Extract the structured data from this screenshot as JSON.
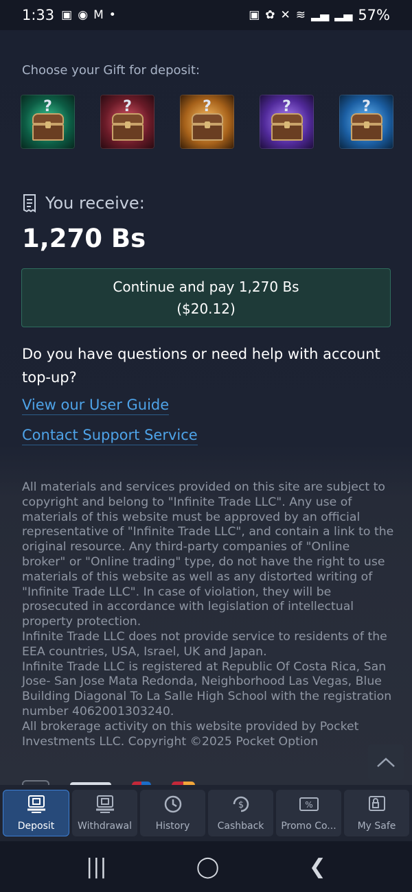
{
  "status_bar": {
    "time": "1:33",
    "battery": "57%",
    "left_icons": [
      "image-icon",
      "chat-icon",
      "gmail-icon",
      "dot-icon"
    ],
    "right_icons": [
      "nfc-icon",
      "leaf-icon",
      "mute-icon",
      "wifi-icon",
      "signal-icon",
      "signal-icon"
    ]
  },
  "gift": {
    "label": "Choose your Gift for deposit:",
    "chests": [
      {
        "color": "#17a37a",
        "mark": "?"
      },
      {
        "color": "#b23a4c",
        "mark": "?"
      },
      {
        "color": "#e19a3b",
        "mark": "?"
      },
      {
        "color": "#7a4bd1",
        "mark": "?"
      },
      {
        "color": "#2f86d6",
        "mark": "?"
      }
    ]
  },
  "receive": {
    "label": "You receive:",
    "amount": "1,270 Bs"
  },
  "pay_button": {
    "line1": "Continue and pay 1,270 Bs",
    "line2": "($20.12)"
  },
  "help": {
    "question": "Do you have questions or need help with account top-up?",
    "guide_link": "View our User Guide",
    "support_link": "Contact Support Service"
  },
  "legal": {
    "p1": "All materials and services provided on this site are subject to copyright and belong to \"Infinite Trade LLC\". Any use of materials of this website must be approved by an official representative of \"Infinite Trade LLC\", and contain a link to the original resource. Any third-party companies of \"Online broker\" or \"Online trading\" type, do not have the right to use materials of this website as well as any distorted writing of \"Infinite Trade LLC\". In case of violation, they will be prosecuted in accordance with legislation of intellectual property protection.",
    "p2": "Infinite Trade LLC does not provide service to residents of the EEA countries, USA, Israel, UK and Japan.",
    "p3": "Infinite Trade LLC is registered at Republic Of Costa Rica, San Jose- San Jose Mata Redonda, Neighborhood Las Vegas, Blue Building Diagonal To La Salle High School with the registration number 4062001303240.",
    "p4": "All brokerage activity on this website provided by Pocket Investments LLC. Copyright ©2025 Pocket Option"
  },
  "nav": {
    "items": [
      {
        "label": "Deposit",
        "icon": "deposit-icon",
        "active": true
      },
      {
        "label": "Withdrawal",
        "icon": "withdrawal-icon",
        "active": false
      },
      {
        "label": "History",
        "icon": "history-icon",
        "active": false
      },
      {
        "label": "Cashback",
        "icon": "cashback-icon",
        "active": false
      },
      {
        "label": "Promo Co...",
        "icon": "promo-code-icon",
        "active": false
      },
      {
        "label": "My Safe",
        "icon": "safe-icon",
        "active": false
      }
    ]
  },
  "colors": {
    "background": "#1a1f2e",
    "link": "#4ea3e8",
    "pay_button_bg": "#1e3a38",
    "active_nav": "#274a7a"
  }
}
